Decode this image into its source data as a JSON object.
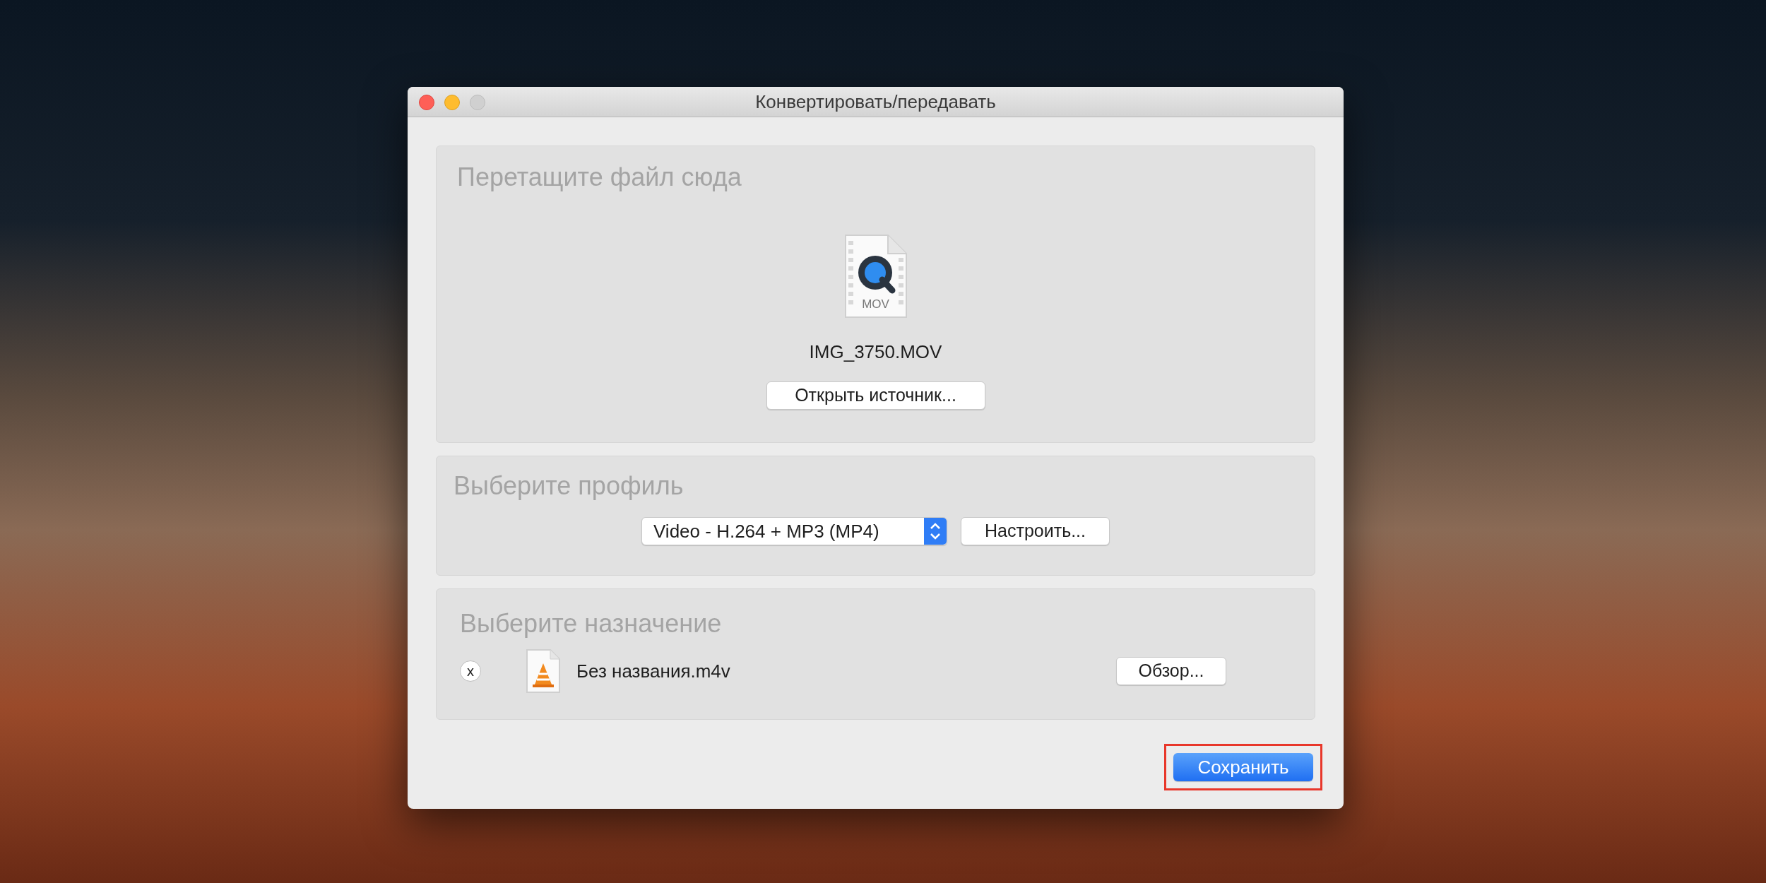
{
  "window": {
    "title": "Конвертировать/передавать",
    "buttons": [
      {
        "kind": "close",
        "disabled": false
      },
      {
        "kind": "minimize",
        "disabled": false
      },
      {
        "kind": "zoom",
        "disabled": true
      }
    ]
  },
  "source": {
    "heading": "Перетащите файл сюда",
    "file_badge": "MOV",
    "file_name": "IMG_3750.MOV",
    "button": "Открыть источник..."
  },
  "profile": {
    "heading": "Выберите профиль",
    "selected_profile": "Video - H.264 + MP3 (MP4)",
    "button": "Настроить..."
  },
  "destination": {
    "heading": "Выберите назначение",
    "remove_button": "x",
    "file_name": "Без названия.m4v",
    "button": "Обзор..."
  },
  "footer": {
    "save_button": "Сохранить",
    "highlighted": true
  }
}
